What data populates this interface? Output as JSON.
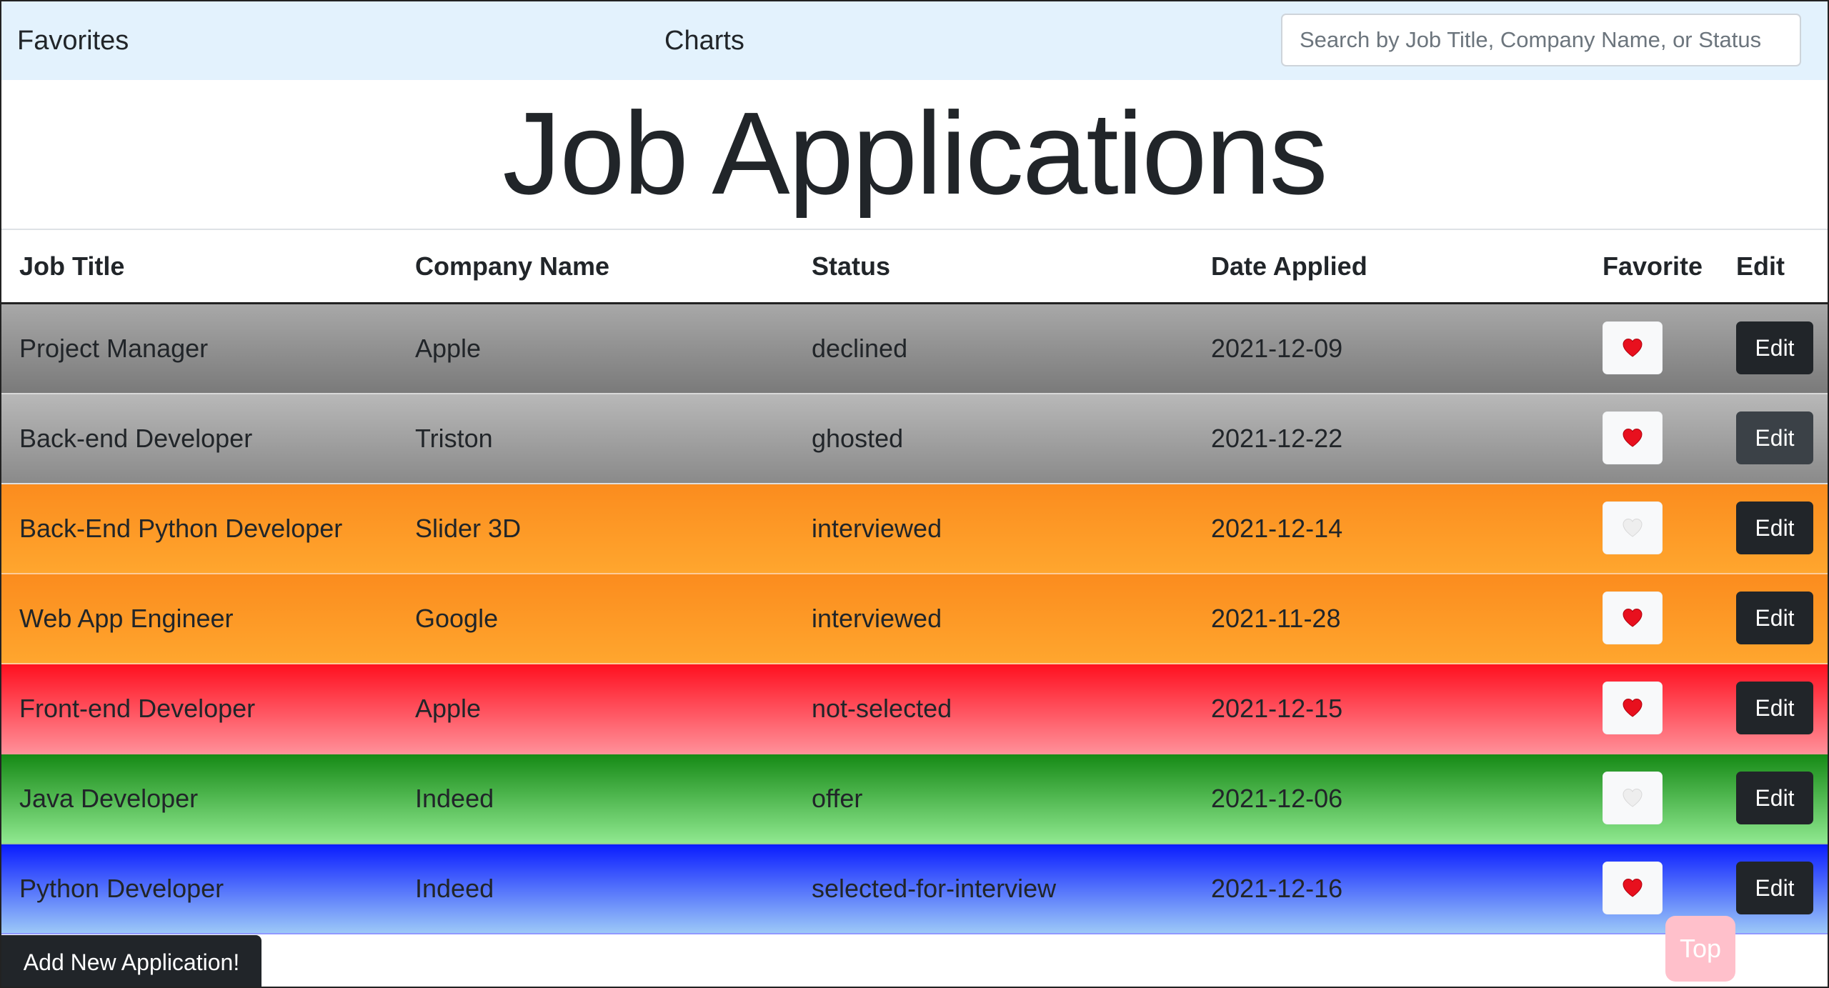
{
  "nav": {
    "favorites": "Favorites",
    "charts": "Charts",
    "search_placeholder": "Search by Job Title, Company Name, or Status"
  },
  "page_title": "Job Applications",
  "table": {
    "headers": {
      "job_title": "Job Title",
      "company_name": "Company Name",
      "status": "Status",
      "date_applied": "Date Applied",
      "favorite": "Favorite",
      "edit": "Edit"
    },
    "rows": [
      {
        "job_title": "Project Manager",
        "company_name": "Apple",
        "status": "declined",
        "date_applied": "2021-12-09",
        "favorite": true,
        "edit_label": "Edit"
      },
      {
        "job_title": "Back-end Developer",
        "company_name": "Triston",
        "status": "ghosted",
        "date_applied": "2021-12-22",
        "favorite": true,
        "edit_label": "Edit"
      },
      {
        "job_title": "Back-End Python Developer",
        "company_name": "Slider 3D",
        "status": "interviewed",
        "date_applied": "2021-12-14",
        "favorite": false,
        "edit_label": "Edit"
      },
      {
        "job_title": "Web App Engineer",
        "company_name": "Google",
        "status": "interviewed",
        "date_applied": "2021-11-28",
        "favorite": true,
        "edit_label": "Edit"
      },
      {
        "job_title": "Front-end Developer",
        "company_name": "Apple",
        "status": "not-selected",
        "date_applied": "2021-12-15",
        "favorite": true,
        "edit_label": "Edit"
      },
      {
        "job_title": "Java Developer",
        "company_name": "Indeed",
        "status": "offer",
        "date_applied": "2021-12-06",
        "favorite": false,
        "edit_label": "Edit"
      },
      {
        "job_title": "Python Developer",
        "company_name": "Indeed",
        "status": "selected-for-interview",
        "date_applied": "2021-12-16",
        "favorite": true,
        "edit_label": "Edit"
      }
    ]
  },
  "status_colors": {
    "declined": [
      "#a8a8a8",
      "#7a7a7a"
    ],
    "ghosted": [
      "#b8b8b8",
      "#8a8a8a"
    ],
    "interviewed": [
      "#fb8c1e",
      "#ffa62e"
    ],
    "not-selected": [
      "#ff1020",
      "#ff8f98"
    ],
    "offer": [
      "#168a16",
      "#8fe88f"
    ],
    "selected-for-interview": [
      "#0a1cff",
      "#9cc8f8"
    ]
  },
  "icons": {
    "favorite_on": "red-heart-icon",
    "favorite_off": "white-heart-icon"
  },
  "footer": {
    "add_button": "Add New Application!",
    "top_button": "Top"
  }
}
